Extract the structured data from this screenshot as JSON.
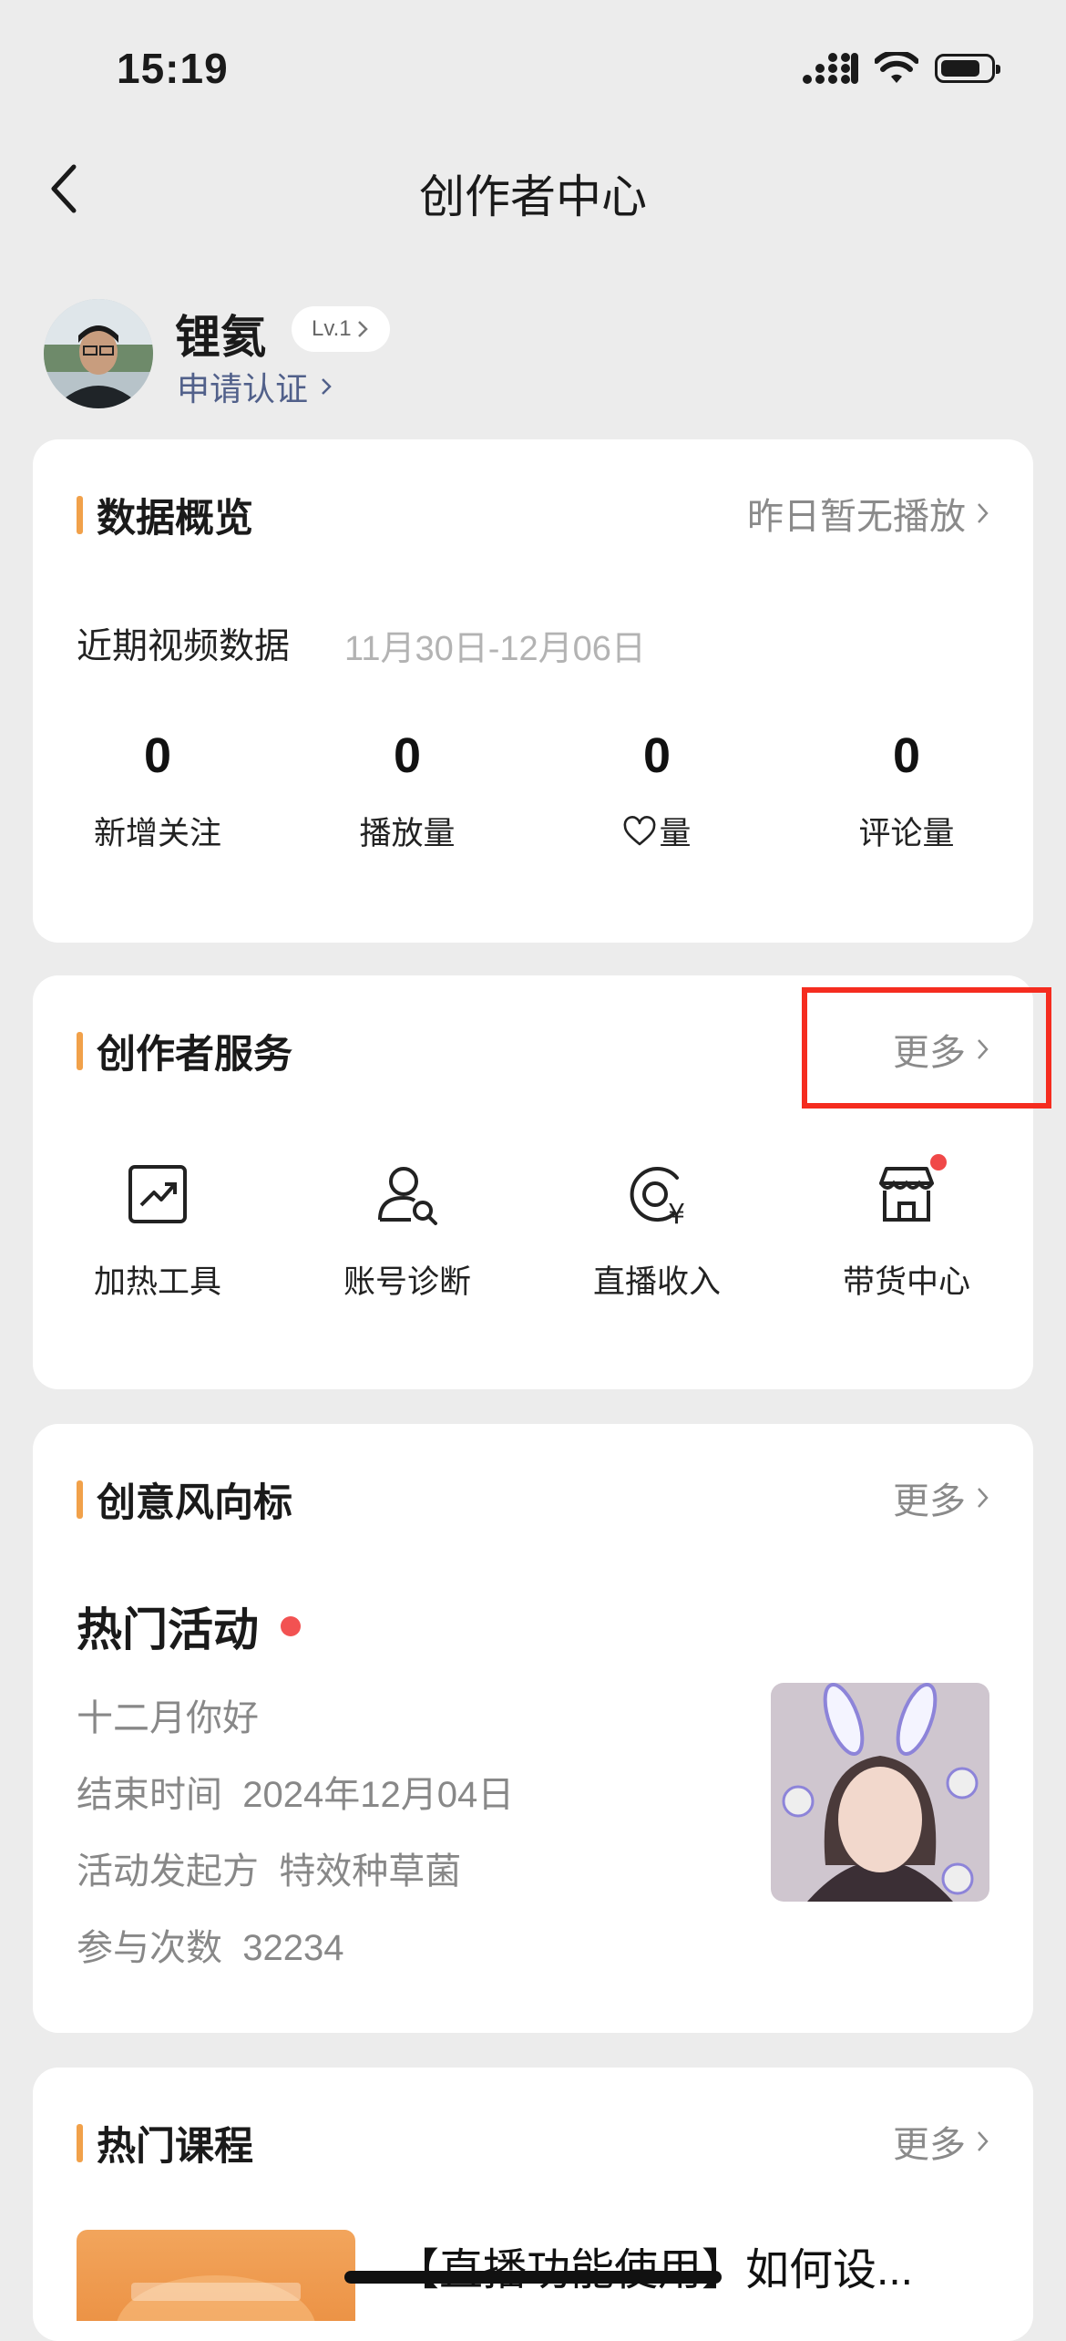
{
  "status_bar": {
    "time": "15:19"
  },
  "nav": {
    "title": "创作者中心"
  },
  "profile": {
    "name": "锂氦",
    "level": "Lv.1",
    "verify_link": "申请认证"
  },
  "data_overview": {
    "title": "数据概览",
    "more": "昨日暂无播放",
    "recent_label": "近期视频数据",
    "date_range": "11月30日-12月06日",
    "stats": [
      {
        "value": "0",
        "label": "新增关注"
      },
      {
        "value": "0",
        "label": "播放量"
      },
      {
        "value": "0",
        "label": "量",
        "icon": "heart-icon"
      },
      {
        "value": "0",
        "label": "评论量"
      }
    ]
  },
  "creator_services": {
    "title": "创作者服务",
    "more": "更多",
    "items": [
      {
        "label": "加热工具",
        "icon": "trend-chart-icon"
      },
      {
        "label": "账号诊断",
        "icon": "user-search-icon"
      },
      {
        "label": "直播收入",
        "icon": "live-income-icon"
      },
      {
        "label": "带货中心",
        "icon": "store-icon"
      }
    ]
  },
  "trend": {
    "title": "创意风向标",
    "more": "更多",
    "activity_title": "热门活动",
    "activity_name": "十二月你好",
    "end_label": "结束时间",
    "end_value": "2024年12月04日",
    "initiator_label": "活动发起方",
    "initiator_value": "特效种草菌",
    "count_label": "参与次数",
    "count_value": "32234"
  },
  "courses": {
    "title": "热门课程",
    "more": "更多",
    "course_title": "【直播功能使用】如何设..."
  },
  "colors": {
    "accent_bar": "#f1a14a",
    "highlight_box": "#f52c1f",
    "link": "#51608a"
  }
}
